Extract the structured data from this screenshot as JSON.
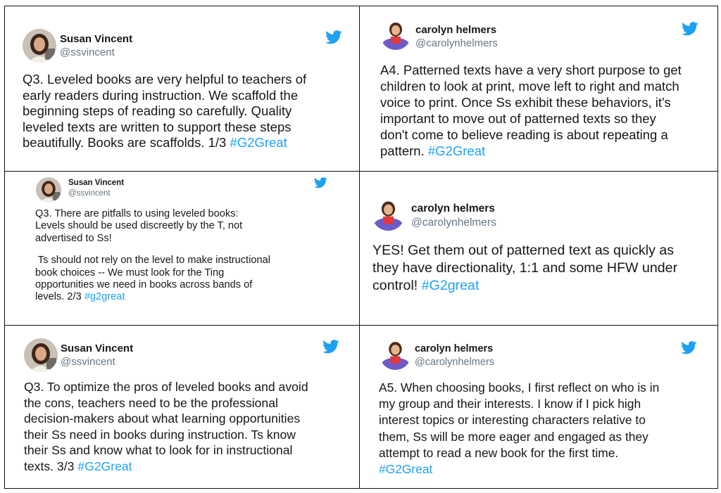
{
  "colors": {
    "hashtag": "#1da1f2",
    "bird": "#1da1f2",
    "handle": "#657786",
    "text": "#14171a",
    "border": "#111111"
  },
  "icons": {
    "brand": "twitter-bird-icon",
    "avatar_susan": "profile-photo",
    "avatar_carolyn": "bitmoji-avatar"
  },
  "tweets": [
    {
      "name": "Susan Vincent",
      "handle": "@ssvincent",
      "lines": [
        "Q3. Leveled books are very helpful to teachers of",
        "early readers during instruction. We scaffold the",
        "beginning steps of reading so carefully. Quality",
        "leveled texts are written to support these steps",
        "beautifully. Books are scaffolds. 1/3 "
      ],
      "hashtag": "#G2Great"
    },
    {
      "name": "carolyn helmers",
      "handle": "@carolynhelmers",
      "lines": [
        "A4. Patterned texts have a very short purpose to get",
        "children to look at print, move left to right and match",
        "voice to print. Once Ss exhibit these behaviors, it's",
        "important to move out of patterned texts so they",
        "don't come to believe reading is about repeating a",
        "pattern. "
      ],
      "hashtag": "#G2Great"
    },
    {
      "name": "Susan Vincent",
      "handle": "@ssvincent",
      "lines": [
        "Q3. There are pitfalls to using leveled books:",
        "Levels should be used discreetly by the T, not",
        "advertised to Ss!"
      ],
      "lines2": [
        " Ts should not rely on the level to make instructional",
        "book choices -- We must look for the Ting",
        "opportunities we need in books across bands of",
        "levels. 2/3 "
      ],
      "hashtag": "#g2great"
    },
    {
      "name": "carolyn helmers",
      "handle": "@carolynhelmers",
      "lines": [
        "YES! Get them out of patterned text as quickly as",
        "they have directionality, 1:1 and some HFW under",
        "control! "
      ],
      "hashtag": "#G2great"
    },
    {
      "name": "Susan Vincent",
      "handle": "@ssvincent",
      "lines": [
        "Q3. To optimize the pros of leveled books and avoid",
        "the cons, teachers need to be the professional",
        "decision-makers about what learning opportunities",
        "their Ss need in books during instruction. Ts know",
        "their Ss and know what to look for in instructional",
        "texts. 3/3 "
      ],
      "hashtag": "#G2Great"
    },
    {
      "name": "carolyn helmers",
      "handle": "@carolynhelmers",
      "lines": [
        "A5. When choosing books, I first reflect on who is in",
        "my group and their interests. I know if I pick high",
        "interest topics or interesting characters relative to",
        "them, Ss will be more eager and engaged as they",
        "attempt to read a new book for the first time."
      ],
      "hashtag": "#G2Great"
    }
  ]
}
